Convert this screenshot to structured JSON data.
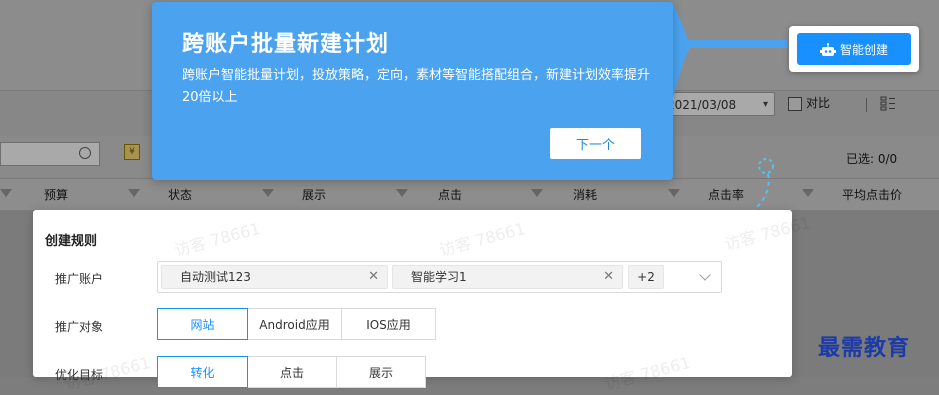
{
  "tooltip": {
    "title": "跨账户批量新建计划",
    "description": "跨账户智能批量计划，投放策略，定向，素材等智能搭配组合，新建计划效率提升20倍以上",
    "next_label": "下一个"
  },
  "ai_create": {
    "label": "智能创建",
    "icon": "robot-icon"
  },
  "toolbar": {
    "date_value": "2021/03/08",
    "compare_label": "对比",
    "selected_count": "已选: 0/0"
  },
  "table": {
    "columns": [
      "预算",
      "状态",
      "展示",
      "点击",
      "消耗",
      "点击率",
      "平均点击价"
    ]
  },
  "watermark": "访客 78661",
  "rule_panel": {
    "title": "创建规则",
    "account": {
      "label": "推广账户",
      "tags": [
        "自动测试123",
        "智能学习1"
      ],
      "more": "+2"
    },
    "target": {
      "label": "推广对象",
      "options": [
        "网站",
        "Android应用",
        "IOS应用"
      ],
      "selected": "网站"
    },
    "goal": {
      "label": "优化目标",
      "options": [
        "转化",
        "点击",
        "展示"
      ],
      "selected": "转化"
    }
  },
  "brand_watermark": "最需教育",
  "colors": {
    "primary": "#1890ff",
    "tooltip_bg": "#4ba3ef",
    "brand": "#1c3aa8"
  }
}
